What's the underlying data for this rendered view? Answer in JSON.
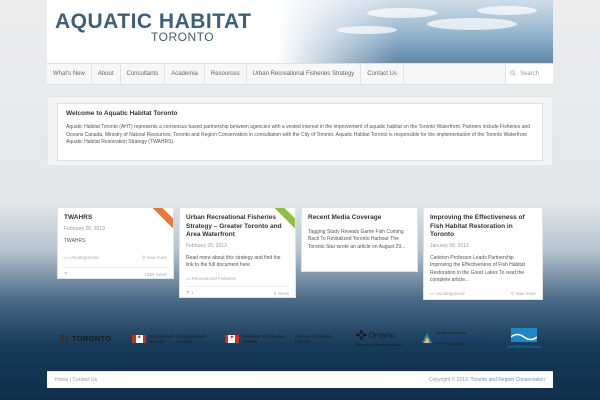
{
  "logo": {
    "main": "AQUATIC HABITAT",
    "sub": "TORONTO"
  },
  "nav": {
    "items": [
      "What's New",
      "About",
      "Consultants",
      "Academia",
      "Resources",
      "Urban Recreational Fisheries Strategy",
      "Contact Us"
    ],
    "search_placeholder": "Search"
  },
  "welcome": {
    "title": "Welcome to Aquatic Habitat Toronto",
    "text": "Aquatic Habitat Toronto (AHT) represents a consensus based partnership between agencies with a vested interest in the improvement of aquatic habitat on the Toronto Waterfront. Partners include Fisheries and Oceans Canada, Ministry of Natural Resources, Toronto and Region Conservation in consultation with the City of Toronto. Aquatic Habitat Toronto is responsible for the implementation of the Toronto Waterfront Aquatic Habitat Restoration Strategy (TWAHRS)."
  },
  "cards": [
    {
      "title": "TWAHRS",
      "date": "February 20, 2013",
      "body": "TWAHRS",
      "category": "Uncategorized",
      "read_more": "read more",
      "views": "1559 views",
      "ribbon_color": "#e8773a"
    },
    {
      "title": "Urban Recreational Fisheries Strategy – Greater Toronto and Area Waterfront",
      "date": "February 20, 2013",
      "body": "Read more about this strategy and find the link to the full document here.",
      "category": "Recreational Fisheries",
      "likes": "1",
      "views": "6 views",
      "ribbon_color": "#8cbf3f"
    },
    {
      "title": "Recent Media Coverage",
      "body": "Tagging Study Reveals Game Fish Coming Back To Revitalized Toronto Harbour The Toronto Star wrote an article on August 29..."
    },
    {
      "title": "Improving the Effectiveness of Fish Habitat Restoration in Toronto",
      "date": "January 09, 2013",
      "body": "Carleton Professor Leads Partnership Improving the Effectiveness of Fish Habitat Restoration in the Great Lakes To read the complete article...",
      "category": "Uncategorized",
      "read_more": "read more"
    }
  ],
  "partners": {
    "toronto": "TORONTO",
    "env_canada_en": "Environment Canada",
    "env_canada_fr": "Environnement Canada",
    "dfo_en": "Fisheries and Oceans Canada",
    "dfo_fr": "Pêches et Océans Canada",
    "ontario": "Ontario",
    "ontario_sub": "Ministry of Natural Resources",
    "trca_top": "Toronto and Region",
    "trca_main": "Conservation",
    "trca_sub": "for The Living City",
    "waterfront": "WATERFRONToronto"
  },
  "footer": {
    "home": "Home",
    "contact": "Contact Us",
    "copyright": "Copyright © 2013,",
    "org": "Toronto and Region Conservation"
  },
  "colors": {
    "accent": "#3e5f77",
    "link": "#6a8db0"
  }
}
